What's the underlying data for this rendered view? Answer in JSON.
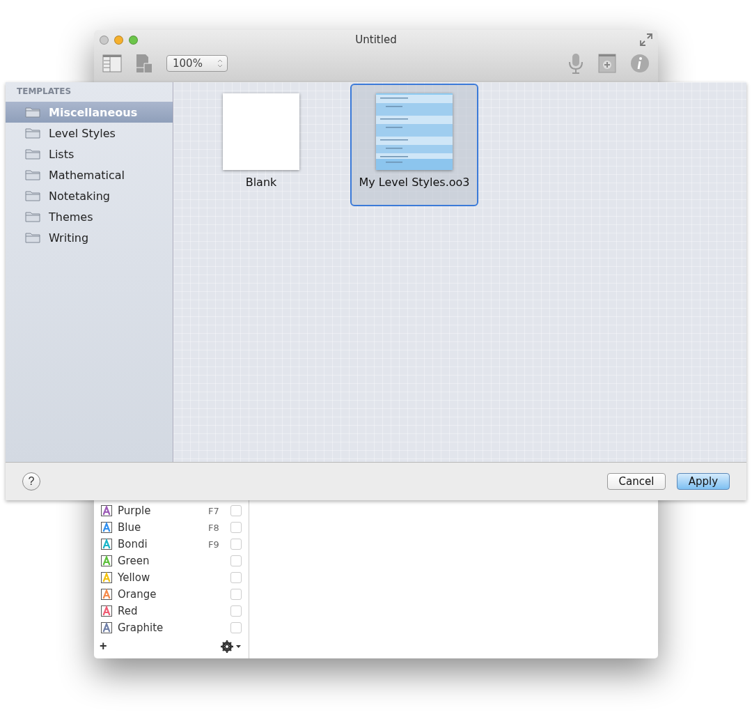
{
  "window": {
    "title": "Untitled",
    "zoom": "100%"
  },
  "styles": {
    "rows": [
      {
        "name": "Purple",
        "kind": "text",
        "key": "F7",
        "color": "#9b59b6",
        "checked": false
      },
      {
        "name": "Blue",
        "kind": "text",
        "key": "F8",
        "color": "#2f8ff0",
        "checked": false
      },
      {
        "name": "Bondi",
        "kind": "text",
        "key": "F9",
        "color": "#1ab5c8",
        "checked": false
      },
      {
        "name": "Green",
        "kind": "text",
        "color": "#5bbf3a",
        "checked": false
      },
      {
        "name": "Yellow",
        "kind": "text",
        "color": "#f4c20d",
        "checked": false
      },
      {
        "name": "Orange",
        "kind": "text",
        "color": "#f58a4b",
        "checked": false
      },
      {
        "name": "Red",
        "kind": "text",
        "color": "#ef5b73",
        "checked": false
      },
      {
        "name": "Graphite",
        "kind": "text",
        "color": "#6f7fa8",
        "checked": false
      }
    ],
    "add": "+"
  },
  "sheet": {
    "sidebar": {
      "heading": "TEMPLATES",
      "items": [
        {
          "label": "Miscellaneous",
          "selected": true
        },
        {
          "label": "Level Styles",
          "selected": false
        },
        {
          "label": "Lists",
          "selected": false
        },
        {
          "label": "Mathematical",
          "selected": false
        },
        {
          "label": "Notetaking",
          "selected": false
        },
        {
          "label": "Themes",
          "selected": false
        },
        {
          "label": "Writing",
          "selected": false
        }
      ]
    },
    "templates": [
      {
        "name": "Blank",
        "kind": "blank",
        "selected": false
      },
      {
        "name": "My Level Styles.oo3",
        "kind": "outline",
        "selected": true
      }
    ],
    "help": "?",
    "buttons": [
      {
        "label": "Cancel",
        "default": false
      },
      {
        "label": "Apply",
        "default": true
      }
    ]
  }
}
